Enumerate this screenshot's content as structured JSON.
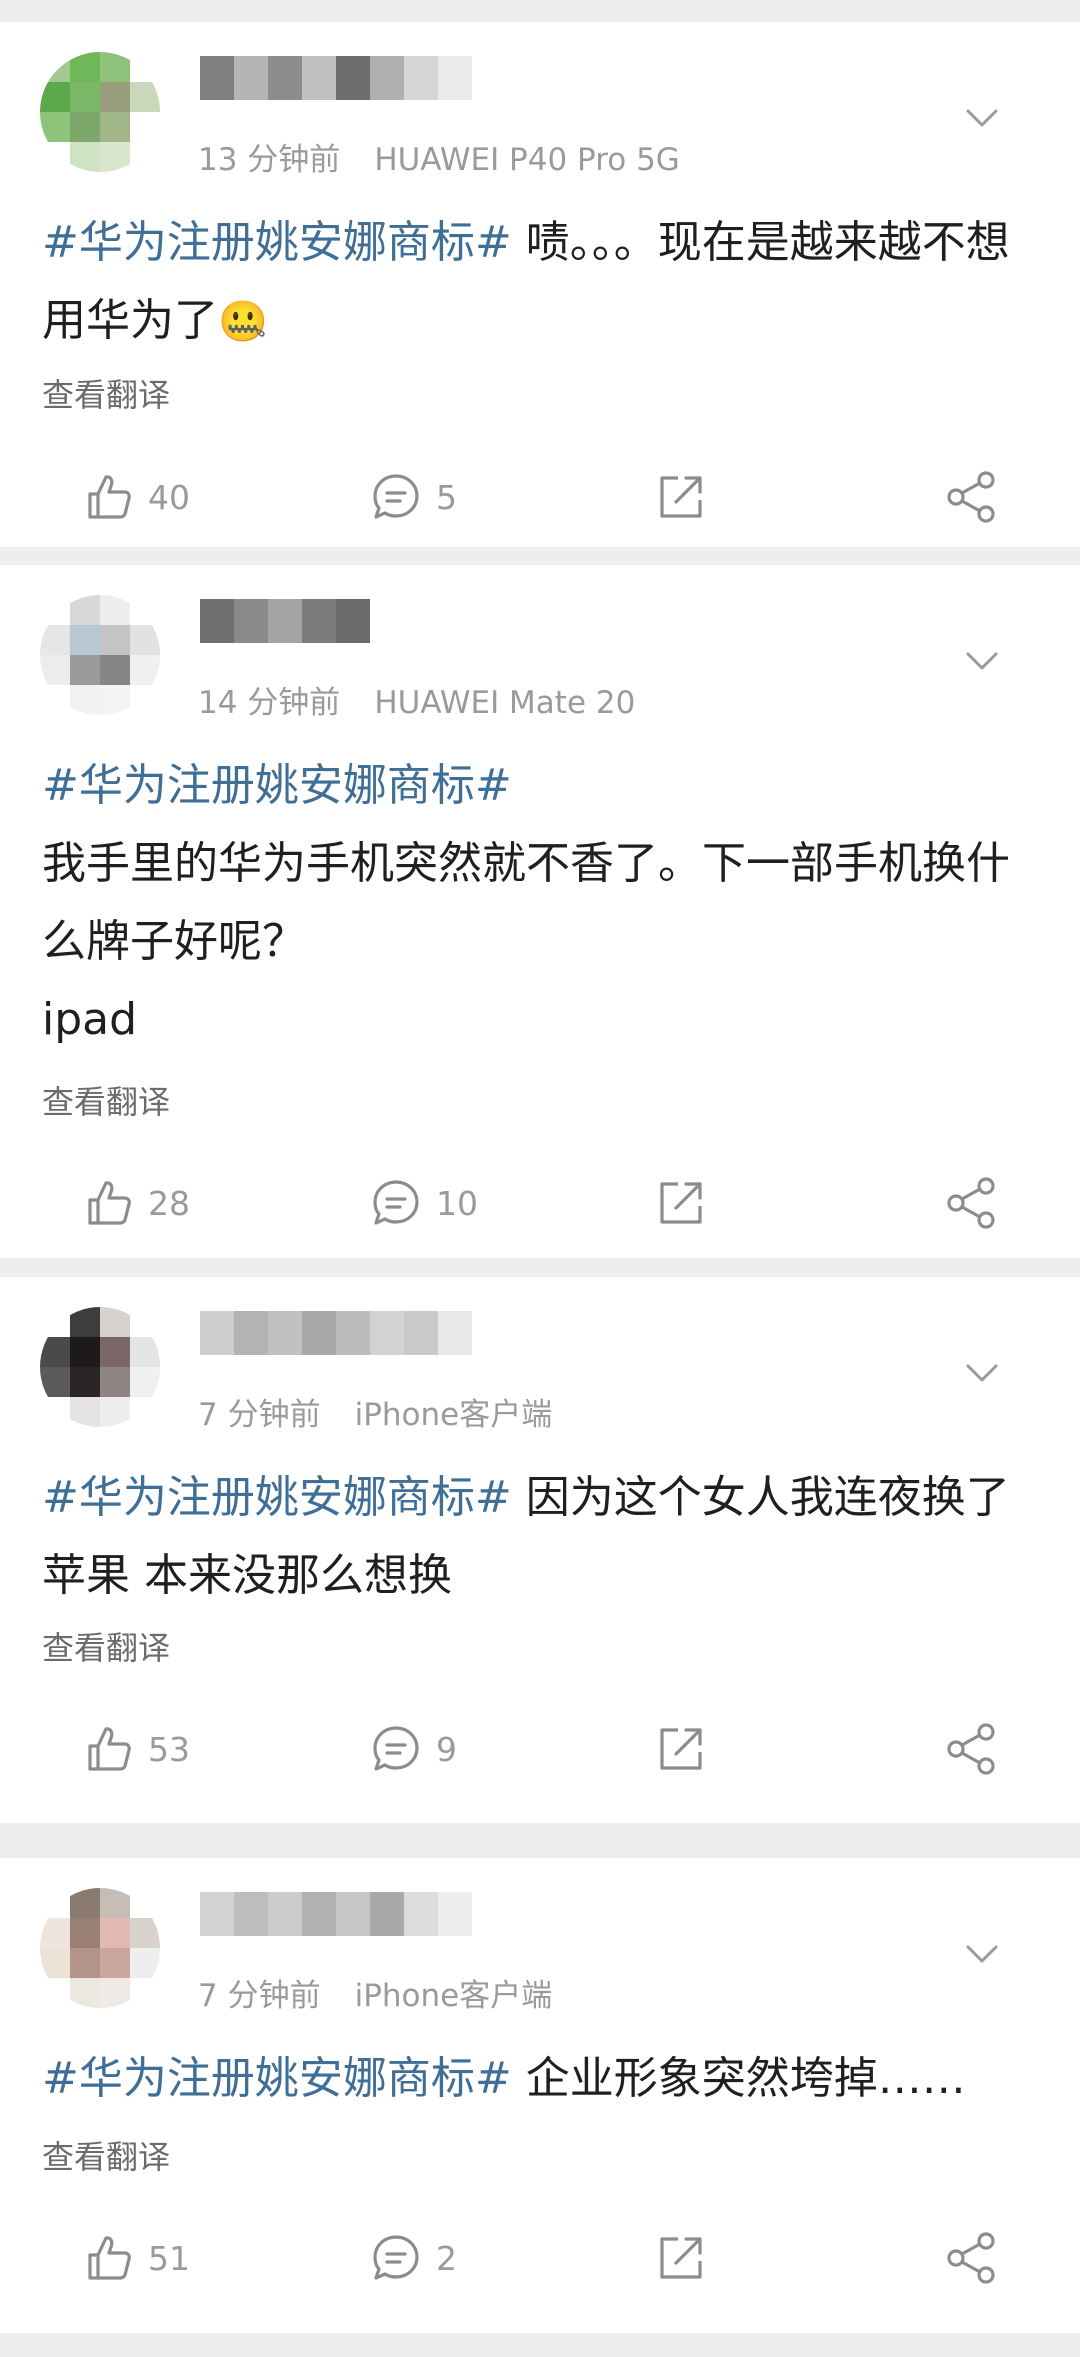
{
  "colors": {
    "hashtag": "#3f6e96",
    "meta_text": "#9a9a9a",
    "icon": "#8c8c8c",
    "separator": "#eeeeee"
  },
  "posts": [
    {
      "time": "13 分钟前",
      "device": "HUAWEI P40 Pro 5G",
      "hashtag": "#华为注册姚安娜商标#",
      "text": " 啧。。。现在是越来越不想用华为了",
      "emoji": "🤐",
      "translate": "查看翻译",
      "likes": "40",
      "comments": "5"
    },
    {
      "time": "14 分钟前",
      "device": "HUAWEI Mate 20",
      "hashtag": "#华为注册姚安娜商标#",
      "lines": [
        "我手里的华为手机突然就不香了。下一部手机换什么牌子好呢？",
        "ipad"
      ],
      "translate": "查看翻译",
      "likes": "28",
      "comments": "10"
    },
    {
      "time": "7 分钟前",
      "device": "iPhone客户端",
      "hashtag": "#华为注册姚安娜商标#",
      "text": " 因为这个女人我连夜换了苹果 本来没那么想换",
      "translate": "查看翻译",
      "likes": "53",
      "comments": "9"
    },
    {
      "time": "7 分钟前",
      "device": "iPhone客户端",
      "hashtag": "#华为注册姚安娜商标#",
      "text": " 企业形象突然垮掉……",
      "translate": "查看翻译",
      "likes": "51",
      "comments": "2"
    }
  ],
  "icons": {
    "like": "thumbs-up-icon",
    "comment": "comment-bubble-icon",
    "repost": "repost-arrow-icon",
    "share": "share-icon",
    "menu": "chevron-down-icon"
  }
}
